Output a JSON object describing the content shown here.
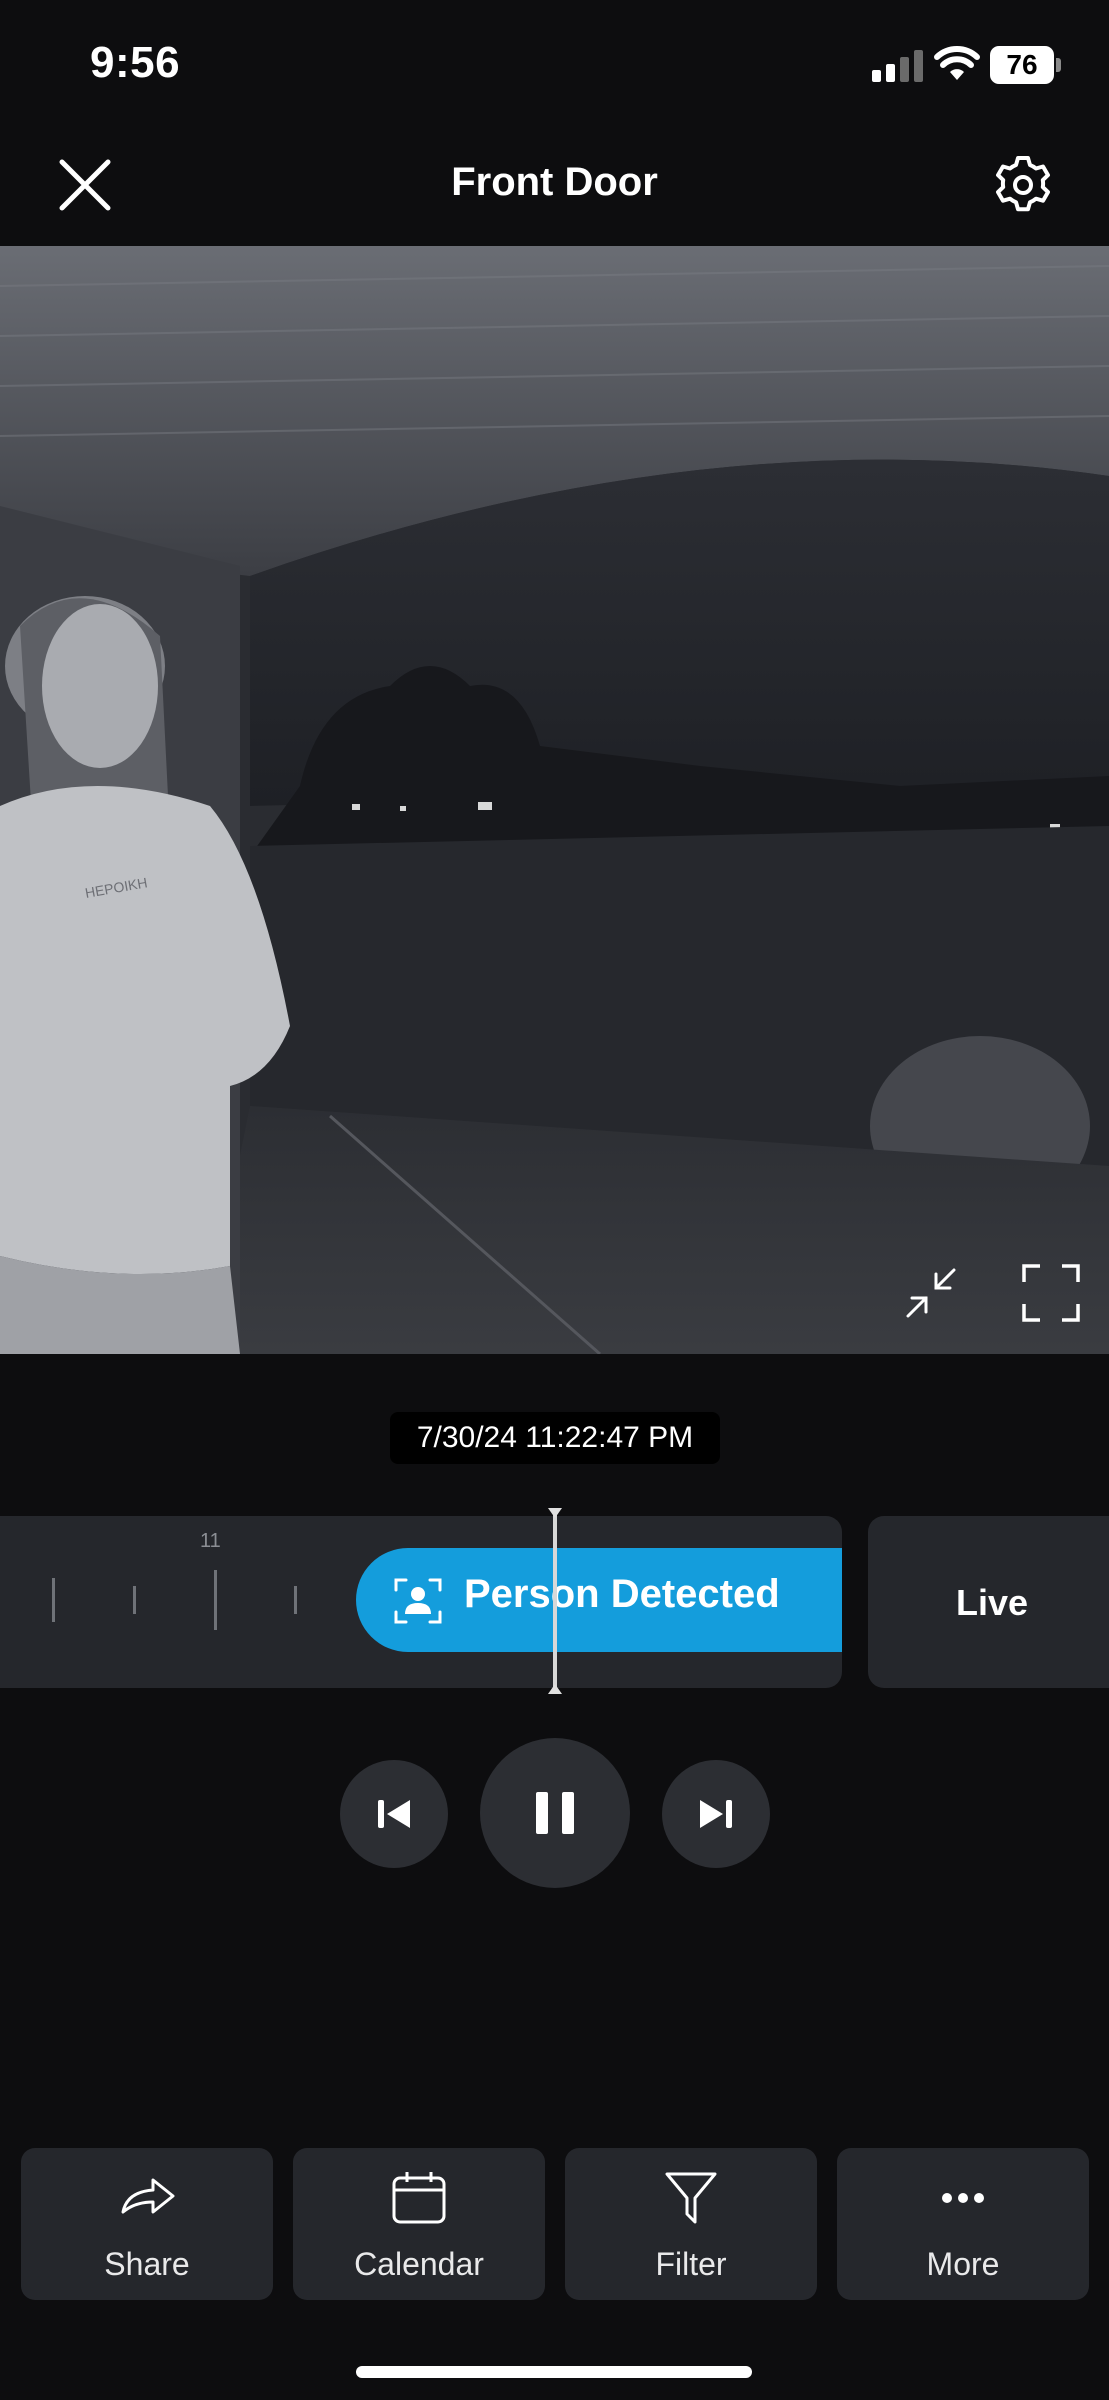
{
  "status_bar": {
    "time": "9:56",
    "battery": "76"
  },
  "header": {
    "title": "Front Door"
  },
  "video": {
    "timestamp": "7/30/24 11:22:47 PM"
  },
  "timeline": {
    "hour_label": "11",
    "event_label": "Person Detected",
    "live_label": "Live"
  },
  "actions": [
    {
      "label": "Share",
      "icon": "share-icon"
    },
    {
      "label": "Calendar",
      "icon": "calendar-icon"
    },
    {
      "label": "Filter",
      "icon": "filter-icon"
    },
    {
      "label": "More",
      "icon": "more-icon"
    }
  ],
  "colors": {
    "accent": "#149ddc",
    "background": "#0d0d0f",
    "surface": "#25272c"
  }
}
